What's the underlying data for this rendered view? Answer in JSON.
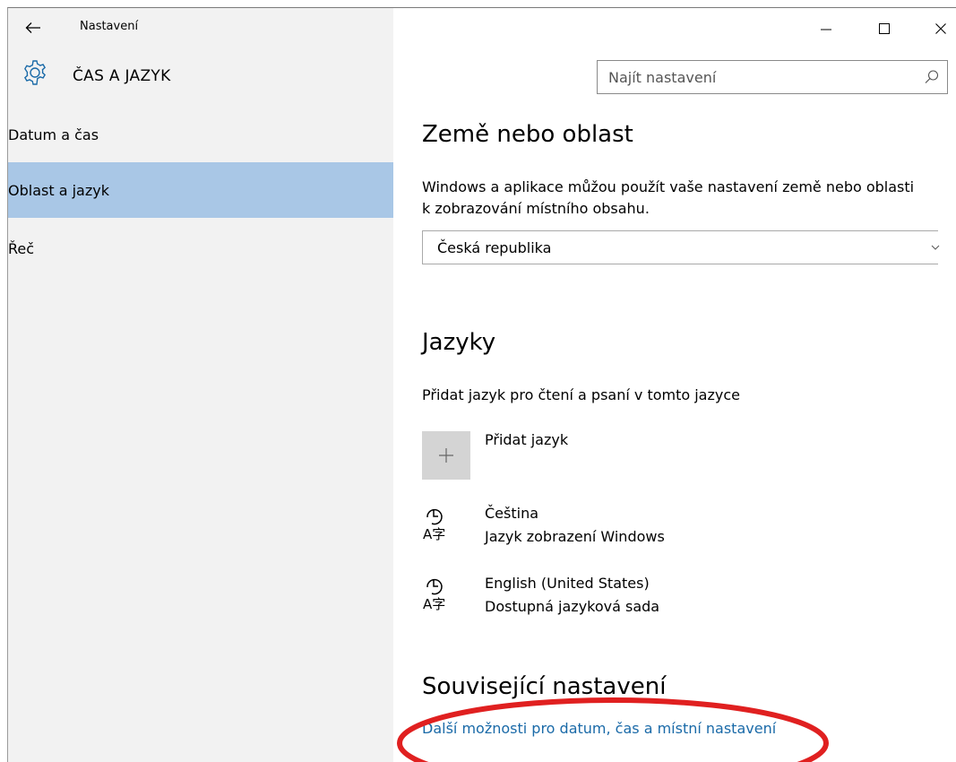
{
  "window": {
    "title": "Nastavení",
    "controls": {
      "minimize": "minimize",
      "maximize": "maximize",
      "close": "close"
    }
  },
  "header": {
    "title": "ČAS A JAZYK",
    "search_placeholder": "Najít nastavení"
  },
  "sidebar": {
    "items": [
      {
        "label": "Datum a čas",
        "selected": false
      },
      {
        "label": "Oblast a jazyk",
        "selected": true
      },
      {
        "label": "Řeč",
        "selected": false
      }
    ]
  },
  "region": {
    "heading": "Země nebo oblast",
    "description": "Windows a aplikace můžou použít vaše nastavení země nebo oblasti k zobrazování místního obsahu.",
    "selected_country": "Česká republika"
  },
  "languages": {
    "heading": "Jazyky",
    "description": "Přidat jazyk pro čtení a psaní v tomto jazyce",
    "add_label": "Přidat jazyk",
    "items": [
      {
        "name": "Čeština",
        "status": "Jazyk zobrazení Windows"
      },
      {
        "name": "English (United States)",
        "status": "Dostupná jazyková sada"
      }
    ]
  },
  "related": {
    "heading": "Související nastavení",
    "link": "Další možnosti pro datum, čas a místní nastavení"
  },
  "colors": {
    "selected_nav": "#a9c7e6",
    "sidebar_bg": "#f2f2f2",
    "link": "#1a6aa8",
    "annotation": "#e02020"
  }
}
